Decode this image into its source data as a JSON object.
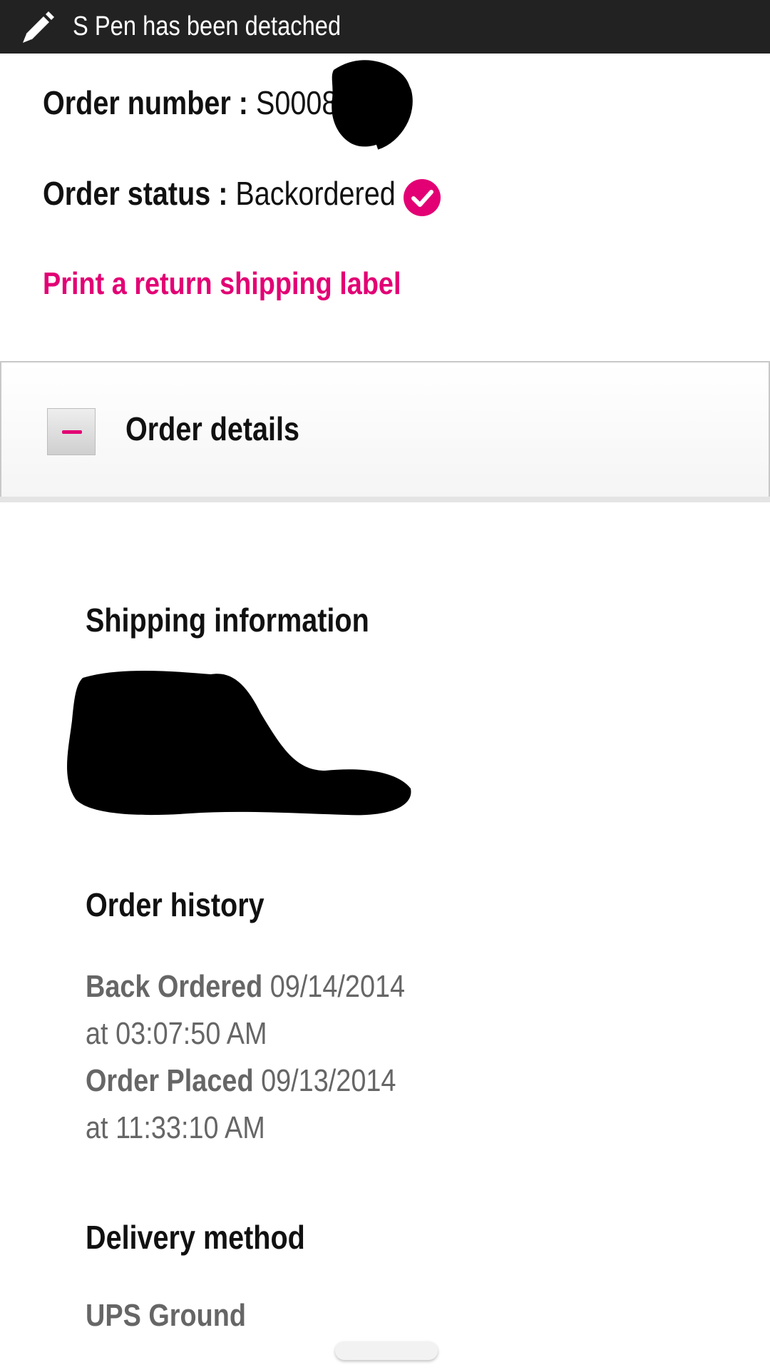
{
  "notification": {
    "icon": "pen-icon",
    "text": "S Pen has been detached"
  },
  "order": {
    "number_label": "Order number :",
    "number_value": "S00082",
    "status_label": "Order status :",
    "status_value": "Backordered",
    "status_icon": "check-circle-icon",
    "return_link": "Print a return shipping label"
  },
  "details_panel": {
    "title": "Order details",
    "toggle_icon": "minus-icon"
  },
  "shipping": {
    "title": "Shipping information"
  },
  "history": {
    "title": "Order history",
    "entries": [
      {
        "label": "Back Ordered",
        "date": "09/14/2014",
        "time": "at 03:07:50 AM"
      },
      {
        "label": "Order Placed",
        "date": "09/13/2014",
        "time": "at 11:33:10 AM"
      }
    ]
  },
  "delivery": {
    "title": "Delivery method",
    "value": "UPS Ground"
  },
  "colors": {
    "accent": "#e20074",
    "notification_bg": "#222222",
    "muted_text": "#666666"
  }
}
